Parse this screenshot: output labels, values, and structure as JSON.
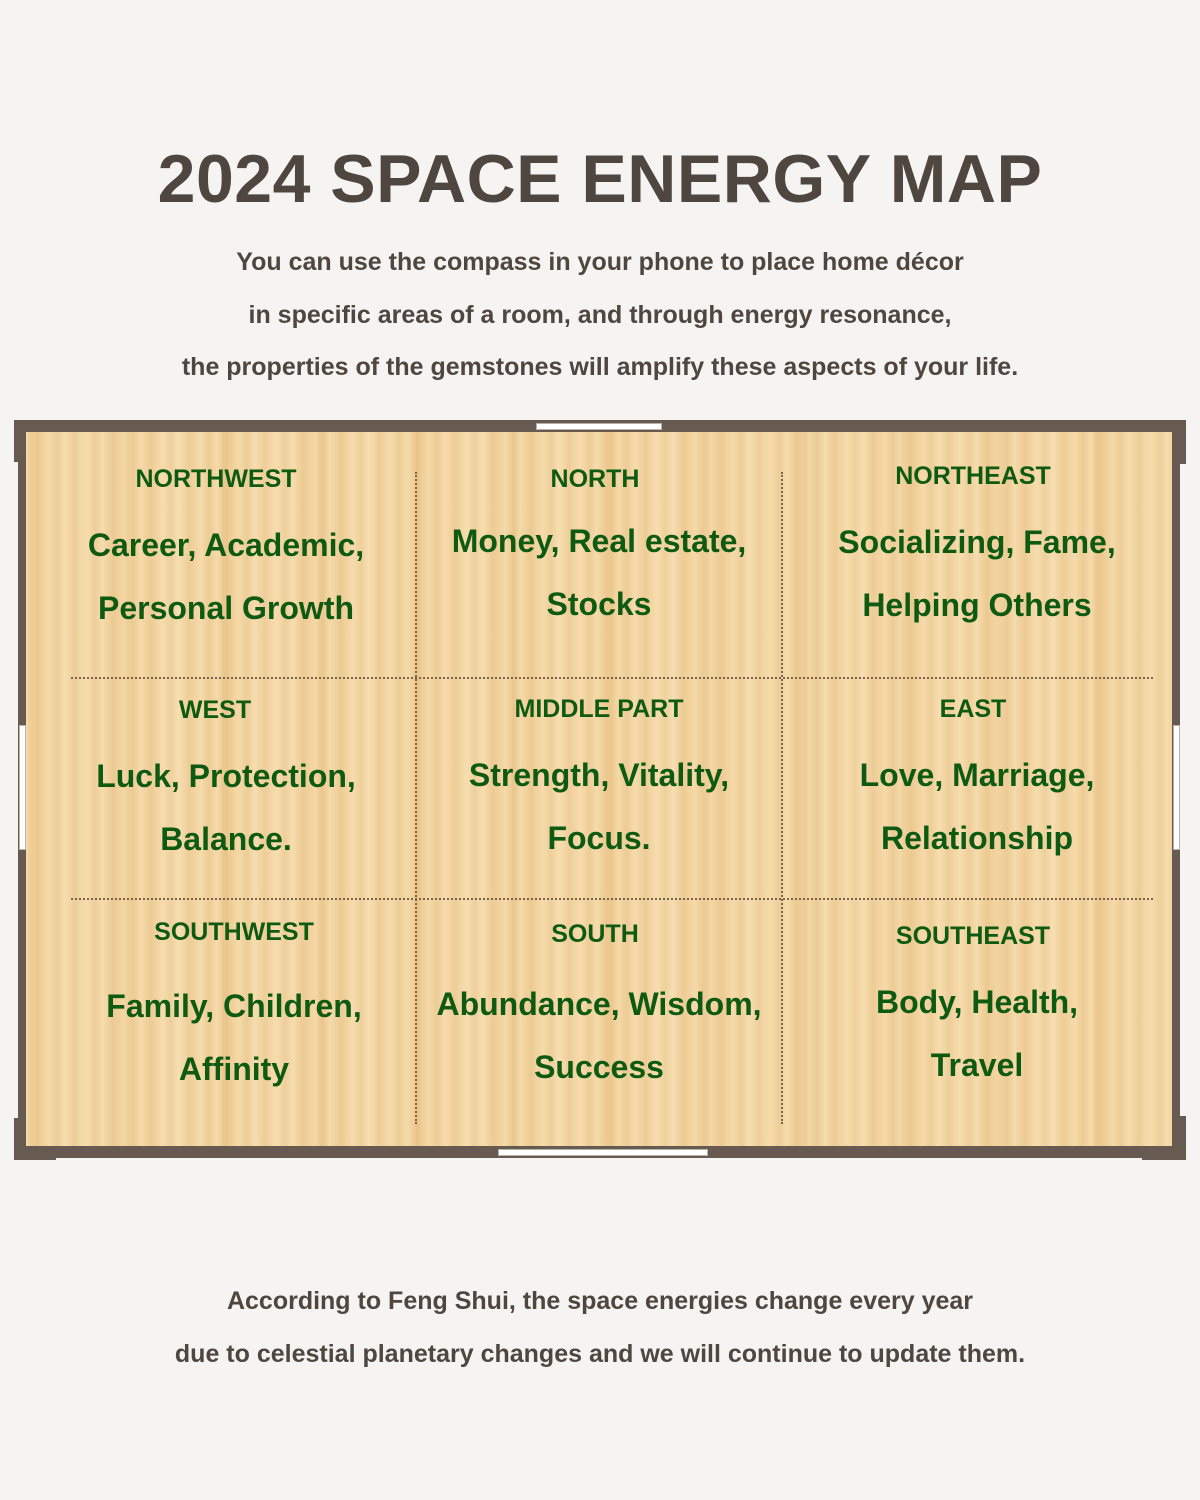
{
  "header": {
    "title": "2024 SPACE ENERGY MAP",
    "intro_lines": [
      "You can use the compass in your phone to place home décor",
      "in specific areas of a room, and through energy resonance,",
      "the properties of the gemstones will amplify these aspects of your life."
    ]
  },
  "colors": {
    "background": "#f5f4f2",
    "text": "#4e463f",
    "cell_text": "#0f5a12",
    "wall": "#675a51",
    "floor": "#f1d09a"
  },
  "map": {
    "cells": [
      {
        "direction": "NORTHWEST",
        "lines": [
          "Career, Academic,",
          "Personal Growth"
        ]
      },
      {
        "direction": "NORTH",
        "lines": [
          "Money, Real estate,",
          "Stocks"
        ]
      },
      {
        "direction": "NORTHEAST",
        "lines": [
          "Socializing, Fame,",
          "Helping Others"
        ]
      },
      {
        "direction": "WEST",
        "lines": [
          "Luck, Protection,",
          "Balance."
        ]
      },
      {
        "direction": "MIDDLE PART",
        "lines": [
          "Strength, Vitality,",
          "Focus."
        ]
      },
      {
        "direction": "EAST",
        "lines": [
          "Love, Marriage,",
          "Relationship"
        ]
      },
      {
        "direction": "SOUTHWEST",
        "lines": [
          "Family, Children,",
          "Affinity"
        ]
      },
      {
        "direction": "SOUTH",
        "lines": [
          "Abundance, Wisdom,",
          "Success"
        ]
      },
      {
        "direction": "SOUTHEAST",
        "lines": [
          "Body, Health,",
          "Travel"
        ]
      }
    ]
  },
  "footer": {
    "lines": [
      "According to Feng Shui, the space energies change every year",
      "due to celestial planetary changes and we will continue to update them."
    ]
  }
}
